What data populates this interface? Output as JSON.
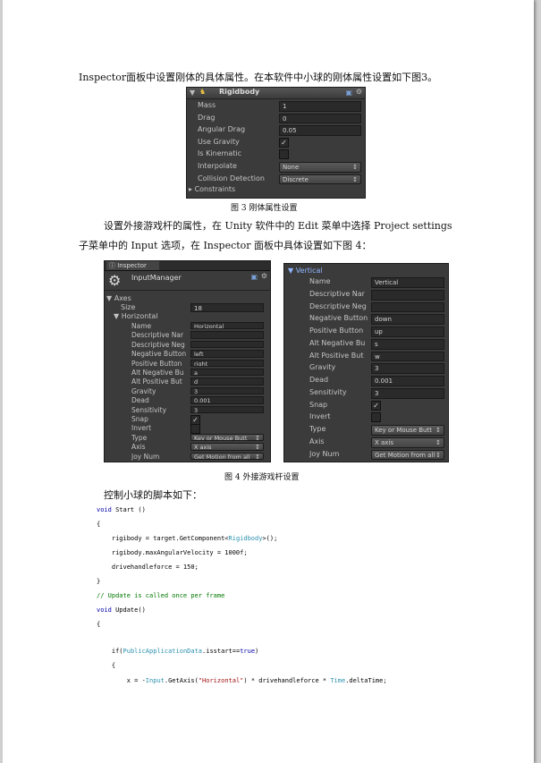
{
  "para1": "Inspector面板中设置刚体的具体属性。在本软件中小球的刚体属性设置如下图3。",
  "fig3": {
    "title": "Rigidbody",
    "rows": [
      {
        "label": "Mass",
        "value": "1",
        "kind": "field"
      },
      {
        "label": "Drag",
        "value": "0",
        "kind": "field"
      },
      {
        "label": "Angular Drag",
        "value": "0.05",
        "kind": "field"
      },
      {
        "label": "Use Gravity",
        "value": "✓",
        "kind": "check"
      },
      {
        "label": "Is Kinematic",
        "value": "",
        "kind": "check"
      },
      {
        "label": "Interpolate",
        "value": "None",
        "kind": "drop"
      },
      {
        "label": "Collision Detection",
        "value": "Discrete",
        "kind": "drop"
      }
    ],
    "constraints": "Constraints",
    "caption": "图 3 刚体属性设置"
  },
  "para2a": "设置外接游戏杆的属性，在 Unity 软件中的 Edit 菜单中选择 Project settings",
  "para2b": "子菜单中的 Input 选项，在 Inspector 面板中具体设置如下图 4：",
  "fig4left": {
    "tab": "Inspector",
    "title": "InputManager",
    "axes": "Axes",
    "size_label": "Size",
    "size_value": "18",
    "group": "Horizontal",
    "rows": [
      {
        "label": "Name",
        "value": "Horizontal",
        "kind": "field"
      },
      {
        "label": "Descriptive Nar",
        "value": "",
        "kind": "field"
      },
      {
        "label": "Descriptive Neg",
        "value": "",
        "kind": "field"
      },
      {
        "label": "Negative Button",
        "value": "left",
        "kind": "field"
      },
      {
        "label": "Positive Button",
        "value": "right",
        "kind": "field"
      },
      {
        "label": "Alt Negative Bu",
        "value": "a",
        "kind": "field"
      },
      {
        "label": "Alt Positive But",
        "value": "d",
        "kind": "field"
      },
      {
        "label": "Gravity",
        "value": "3",
        "kind": "field"
      },
      {
        "label": "Dead",
        "value": "0.001",
        "kind": "field"
      },
      {
        "label": "Sensitivity",
        "value": "3",
        "kind": "field"
      },
      {
        "label": "Snap",
        "value": "✓",
        "kind": "check"
      },
      {
        "label": "Invert",
        "value": "",
        "kind": "check"
      },
      {
        "label": "Type",
        "value": "Key or Mouse Butt",
        "kind": "drop"
      },
      {
        "label": "Axis",
        "value": "X axis",
        "kind": "drop"
      },
      {
        "label": "Joy Num",
        "value": "Get Motion from all",
        "kind": "drop"
      }
    ]
  },
  "fig4right": {
    "group": "Vertical",
    "rows": [
      {
        "label": "Name",
        "value": "Vertical",
        "kind": "field"
      },
      {
        "label": "Descriptive Nar",
        "value": "",
        "kind": "field"
      },
      {
        "label": "Descriptive Neg",
        "value": "",
        "kind": "field"
      },
      {
        "label": "Negative Button",
        "value": "down",
        "kind": "field"
      },
      {
        "label": "Positive Button",
        "value": "up",
        "kind": "field"
      },
      {
        "label": "Alt Negative Bu",
        "value": "s",
        "kind": "field"
      },
      {
        "label": "Alt Positive But",
        "value": "w",
        "kind": "field"
      },
      {
        "label": "Gravity",
        "value": "3",
        "kind": "field"
      },
      {
        "label": "Dead",
        "value": "0.001",
        "kind": "field"
      },
      {
        "label": "Sensitivity",
        "value": "3",
        "kind": "field"
      },
      {
        "label": "Snap",
        "value": "✓",
        "kind": "check"
      },
      {
        "label": "Invert",
        "value": "",
        "kind": "check"
      },
      {
        "label": "Type",
        "value": "Key or Mouse Butt",
        "kind": "drop"
      },
      {
        "label": "Axis",
        "value": "X axis",
        "kind": "drop"
      },
      {
        "label": "Joy Num",
        "value": "Get Motion from all",
        "kind": "drop"
      }
    ]
  },
  "fig4caption": "图 4 外接游戏杆设置",
  "para3": "控制小球的脚本如下：",
  "code": [
    [
      {
        "t": "void",
        "c": "kw"
      },
      {
        "t": " Start ()",
        "c": ""
      }
    ],
    [
      {
        "t": "{",
        "c": ""
      }
    ],
    [
      {
        "t": "    rigibody = target.GetComponent<",
        "c": ""
      },
      {
        "t": "Rigidbody",
        "c": "cls"
      },
      {
        "t": ">();",
        "c": ""
      }
    ],
    [
      {
        "t": "    rigibody.maxAngularVelocity = 1000f;",
        "c": ""
      }
    ],
    [
      {
        "t": "    drivehandleforce = 150;",
        "c": ""
      }
    ],
    [
      {
        "t": "}",
        "c": ""
      }
    ],
    [
      {
        "t": "// Update is called once per frame",
        "c": "cm"
      }
    ],
    [
      {
        "t": "void",
        "c": "kw"
      },
      {
        "t": " Update()",
        "c": ""
      }
    ],
    [
      {
        "t": "{",
        "c": ""
      }
    ],
    [
      {
        "t": "",
        "c": ""
      }
    ],
    [
      {
        "t": "    if(",
        "c": ""
      },
      {
        "t": "PublicApplicationData",
        "c": "cls"
      },
      {
        "t": ".isstart==",
        "c": ""
      },
      {
        "t": "true",
        "c": "kw"
      },
      {
        "t": ")",
        "c": ""
      }
    ],
    [
      {
        "t": "    {",
        "c": ""
      }
    ],
    [
      {
        "t": "        x = -",
        "c": ""
      },
      {
        "t": "Input",
        "c": "cls"
      },
      {
        "t": ".GetAxis(",
        "c": ""
      },
      {
        "t": "\"Horizontal\"",
        "c": "str"
      },
      {
        "t": ") * drivehandleforce * ",
        "c": ""
      },
      {
        "t": "Time",
        "c": "cls"
      },
      {
        "t": ".deltaTime;",
        "c": ""
      }
    ]
  ]
}
